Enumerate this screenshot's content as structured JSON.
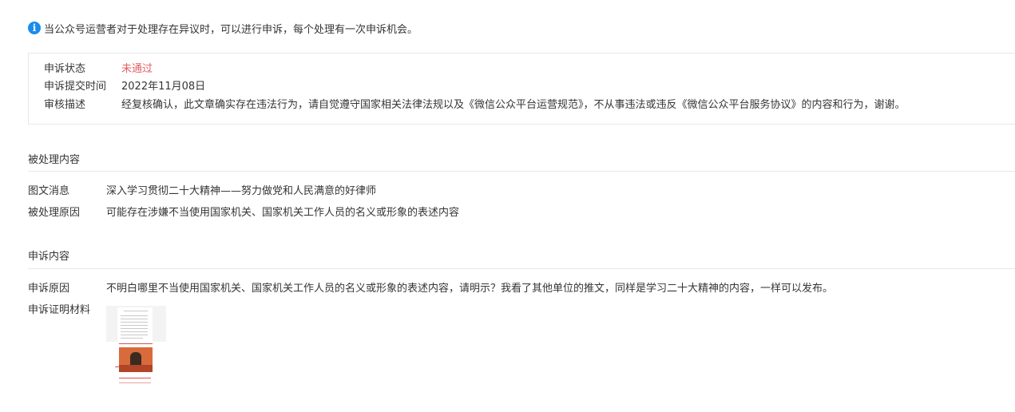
{
  "notice": {
    "icon": "info-icon",
    "text": "当公众号运营者对于处理存在异议时，可以进行申诉，每个处理有一次申诉机会。"
  },
  "status": {
    "status_label": "申诉状态",
    "status_value": "未通过",
    "status_color": "#e15f63",
    "submit_time_label": "申诉提交时间",
    "submit_time_value": "2022年11月08日",
    "review_label": "审核描述",
    "review_value": "经复核确认，此文章确实存在违法行为，请自觉遵守国家相关法律法规以及《微信公众平台运营规范》，不从事违法或违反《微信公众平台服务协议》的内容和行为，谢谢。"
  },
  "handled": {
    "title": "被处理内容",
    "message_label": "图文消息",
    "message_value": "深入学习贯彻二十大精神——努力做党和人民满意的好律师",
    "reason_label": "被处理原因",
    "reason_value": "可能存在涉嫌不当使用国家机关、国家机关工作人员的名义或形象的表述内容"
  },
  "appeal": {
    "title": "申诉内容",
    "reason_label": "申诉原因",
    "reason_value": "不明白哪里不当使用国家机关、国家机关工作人员的名义或形象的表述内容，请明示？我看了其他单位的推文，同样是学习二十大精神的内容，一样可以发布。",
    "evidence_label": "申诉证明材料"
  },
  "colors": {
    "accent": "#1a8ceb",
    "fail": "#e15f63",
    "border": "#e4e8eb"
  }
}
